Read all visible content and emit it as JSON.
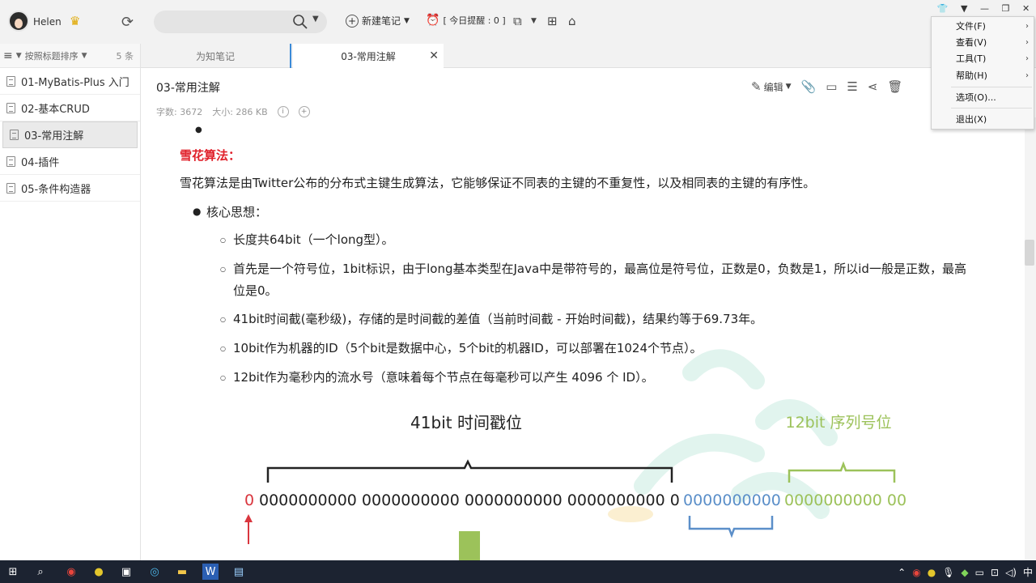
{
  "topbar": {
    "username": "Helen",
    "new_note_label": "新建笔记",
    "reminder_label": "[ 今日提醒 : 0 ]"
  },
  "sidebar": {
    "sort_label": "按照标题排序",
    "count_label": "5 条",
    "items": [
      {
        "label": "01-MyBatis-Plus 入门"
      },
      {
        "label": "02-基本CRUD"
      },
      {
        "label": "03-常用注解"
      },
      {
        "label": "04-插件"
      },
      {
        "label": "05-条件构造器"
      }
    ]
  },
  "tabs": [
    {
      "label": "为知笔记"
    },
    {
      "label": "03-常用注解"
    }
  ],
  "note": {
    "title": "03-常用注解",
    "word_count": "字数: 3672",
    "size": "大小: 286 KB",
    "edit_label": "编辑"
  },
  "content": {
    "heading": "雪花算法：",
    "paragraph": "雪花算法是由Twitter公布的分布式主键生成算法，它能够保证不同表的主键的不重复性，以及相同表的主键的有序性。",
    "core_label": "核心思想：",
    "points": [
      {
        "text": "长度共64bit（一个long型）。"
      },
      {
        "text": "首先是一个符号位，1bit标识，由于long基本类型在Java中是带符号的，最高位是符号位，正数是0，负数是1，所以id一般是正数，最高位是0。"
      },
      {
        "text": "41bit时间截(毫秒级)，存储的是时间截的差值（当前时间截 - 开始时间截)，结果约等于69.73年。"
      },
      {
        "text": "10bit作为机器的ID（5个bit是数据中心，5个bit的机器ID，可以部署在1024个节点）。"
      },
      {
        "text": "12bit作为毫秒内的流水号（意味着每个节点在每毫秒可以产生 4096 个 ID）。"
      }
    ]
  },
  "diagram": {
    "timestamp_label": "41bit 时间戳位",
    "sequence_label": "12bit 序列号位",
    "sign_bit": "0",
    "timestamp_bits": "0000000000 0000000000 0000000000 0000000000 0",
    "machine_bits": "0000000000",
    "sequence_bits": "0000000000 00",
    "colors": {
      "sign": "#d9363e",
      "timestamp": "#222222",
      "machine": "#5b8fc9",
      "sequence": "#9cc25a"
    }
  },
  "menu": {
    "items": [
      {
        "label": "文件(F)",
        "submenu": true
      },
      {
        "label": "查看(V)",
        "submenu": true
      },
      {
        "label": "工具(T)",
        "submenu": true
      },
      {
        "label": "帮助(H)",
        "submenu": true
      },
      {
        "label": "选项(O)...",
        "submenu": false
      },
      {
        "label": "退出(X)",
        "submenu": false
      }
    ]
  },
  "taskbar": {
    "ime": "中"
  }
}
